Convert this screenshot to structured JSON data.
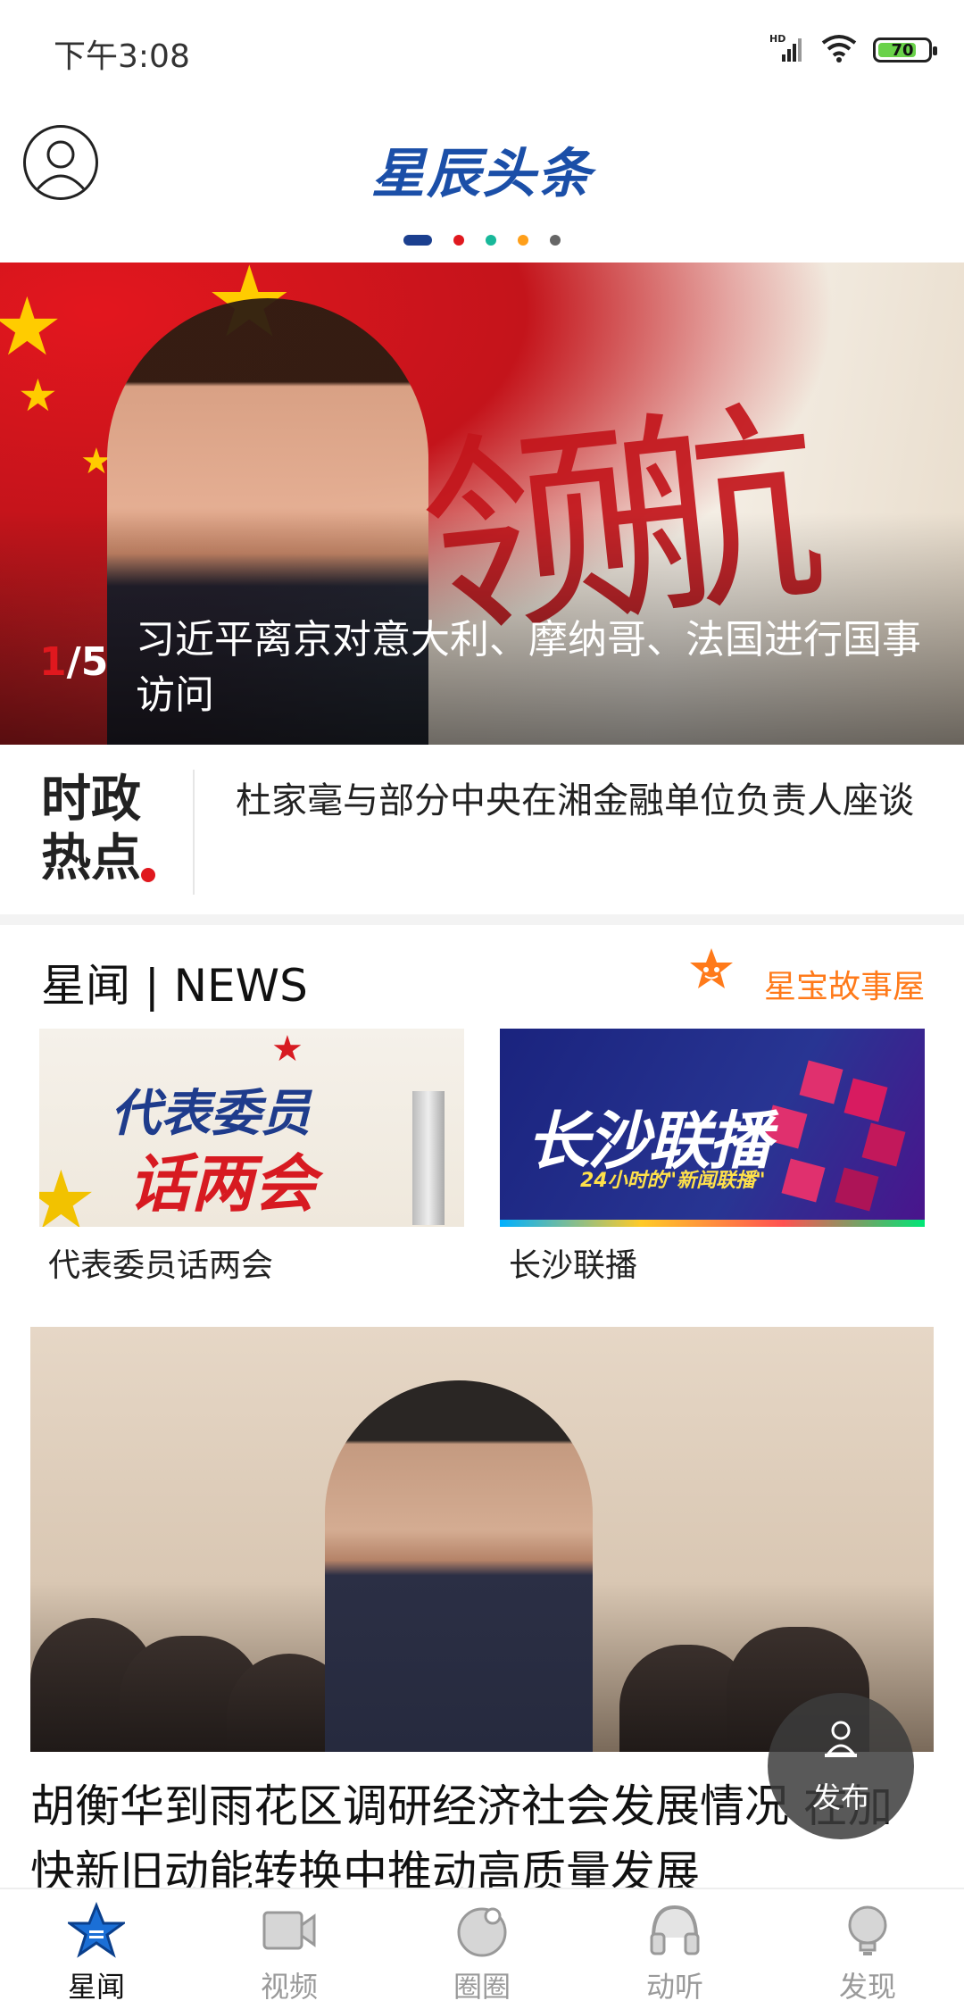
{
  "status_bar": {
    "time": "下午3:08",
    "network": "HD",
    "battery": "70"
  },
  "header": {
    "logo_text": "星辰头条"
  },
  "carousel": {
    "dots": [
      "#1b3f8f",
      "#e0181e",
      "#18b89a",
      "#ff9f1a",
      "#666666"
    ],
    "active_index": 0
  },
  "hero": {
    "counter_current": "1",
    "counter_total": "/5",
    "caption": "习近平离京对意大利、摩纳哥、法国进行国事访问",
    "calligraphy": "领航"
  },
  "hot_topics": {
    "logo_line1": "时政",
    "logo_line2": "热点",
    "headline": "杜家毫与部分中央在湘金融单位负责人座谈"
  },
  "news_section": {
    "title": "星闻 | NEWS",
    "story_link": "星宝故事屋",
    "tiles": [
      {
        "label": "代表委员话两会",
        "image_main": "代表委员",
        "image_sub": "话两会"
      },
      {
        "label": "长沙联播",
        "image_main": "长沙联播",
        "image_sub": "24小时的\"新闻联播\""
      }
    ],
    "featured": {
      "headline": "胡衡华到雨花区调研经济社会发展情况 在加快新旧动能转换中推动高质量发展"
    }
  },
  "publish": {
    "label": "发布"
  },
  "bottom_nav": {
    "items": [
      {
        "label": "星闻",
        "icon": "star-icon",
        "active": true
      },
      {
        "label": "视频",
        "icon": "video-icon",
        "active": false
      },
      {
        "label": "圈圈",
        "icon": "circle-icon",
        "active": false
      },
      {
        "label": "动听",
        "icon": "headphones-icon",
        "active": false
      },
      {
        "label": "发现",
        "icon": "bulb-icon",
        "active": false
      }
    ]
  },
  "colors": {
    "accent_orange": "#ff7a1a",
    "brand_blue": "#1b4fa8",
    "red": "#e0181e"
  }
}
